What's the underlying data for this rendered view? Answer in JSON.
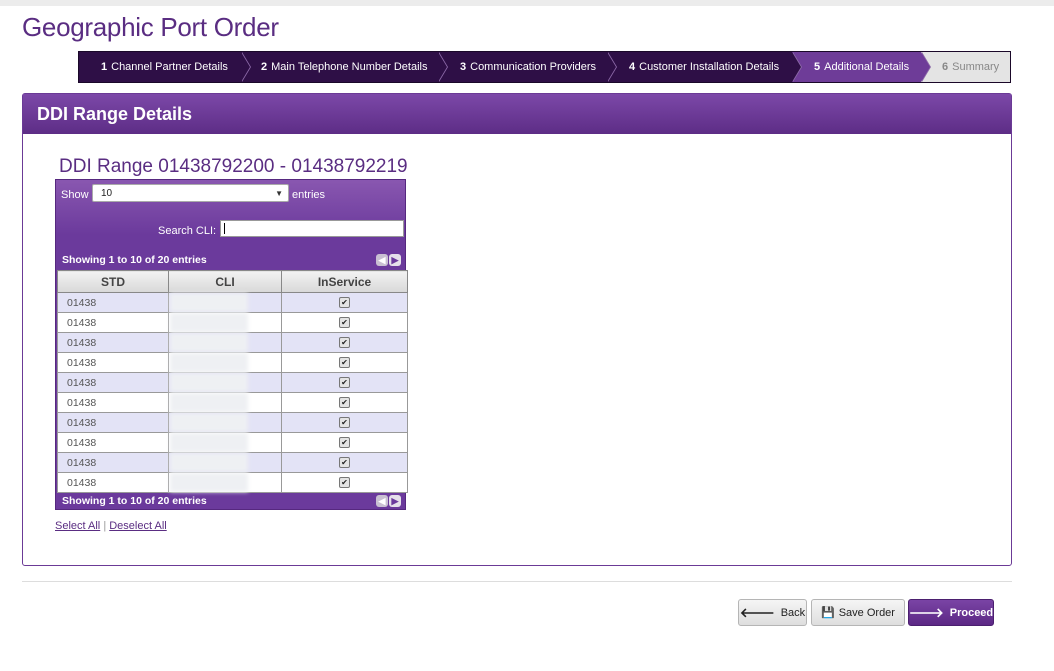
{
  "page": {
    "title": "Geographic Port Order"
  },
  "wizard": {
    "steps": [
      {
        "num": "1",
        "label": "Channel Partner Details"
      },
      {
        "num": "2",
        "label": "Main Telephone Number Details"
      },
      {
        "num": "3",
        "label": "Communication Providers"
      },
      {
        "num": "4",
        "label": "Customer Installation Details"
      },
      {
        "num": "5",
        "label": "Additional Details"
      },
      {
        "num": "6",
        "label": "Summary"
      }
    ]
  },
  "panel": {
    "title": "DDI Range Details"
  },
  "range": {
    "title": "DDI Range 01438792200 - 01438792219"
  },
  "table": {
    "show_label": "Show",
    "page_size": "10",
    "entries_label": "entries",
    "search_label": "Search CLI:",
    "info": "Showing 1 to 10 of 20 entries",
    "columns": [
      "STD",
      "CLI",
      "InService"
    ],
    "rows": [
      {
        "std": "01438",
        "checked": "✔"
      },
      {
        "std": "01438",
        "checked": "✔"
      },
      {
        "std": "01438",
        "checked": "✔"
      },
      {
        "std": "01438",
        "checked": "✔"
      },
      {
        "std": "01438",
        "checked": "✔"
      },
      {
        "std": "01438",
        "checked": "✔"
      },
      {
        "std": "01438",
        "checked": "✔"
      },
      {
        "std": "01438",
        "checked": "✔"
      },
      {
        "std": "01438",
        "checked": "✔"
      },
      {
        "std": "01438",
        "checked": "✔"
      }
    ]
  },
  "links": {
    "select_all": "Select All",
    "separator": "|",
    "deselect_all": "Deselect All"
  },
  "actions": {
    "back": "Back",
    "save": "Save Order",
    "proceed": "Proceed"
  }
}
